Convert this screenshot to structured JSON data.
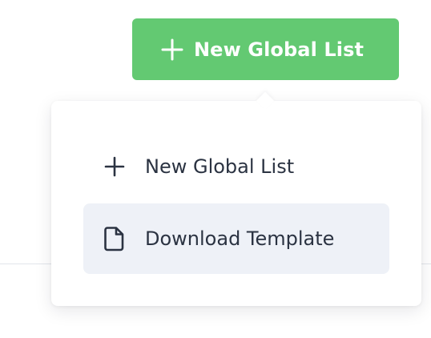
{
  "colors": {
    "primary": "#63c972",
    "menu_text": "#2b3342",
    "highlight": "#eef1f7"
  },
  "primary_button": {
    "label": "New Global List",
    "icon": "plus-icon"
  },
  "dropdown": {
    "items": [
      {
        "label": "New Global List",
        "icon": "plus-icon",
        "highlighted": false
      },
      {
        "label": "Download Template",
        "icon": "document-icon",
        "highlighted": true
      }
    ]
  }
}
